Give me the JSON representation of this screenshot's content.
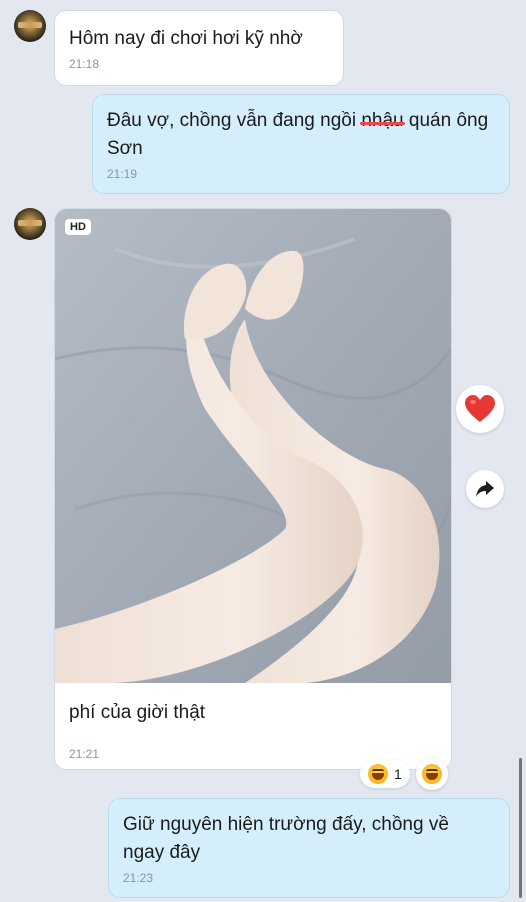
{
  "messages": [
    {
      "text": "Hôm nay đi chơi hơi kỹ nhờ",
      "time": "21:18"
    },
    {
      "text_before": "Đâu vợ, chồng vẫn đang ngồi ",
      "struck": "nhậu",
      "text_after": " quán ông Sơn",
      "time": "21:19"
    },
    {
      "badge": "HD",
      "caption": "phí của giời thật",
      "time": "21:21"
    },
    {
      "text": "Giữ nguyên hiện trường đấy, chồng về ngay đây",
      "time": "21:23"
    }
  ],
  "reaction": {
    "count": "1"
  },
  "colors": {
    "background": "#e3e7f0",
    "incoming": "#ffffff",
    "outgoing": "#d5eefc",
    "heart": "#e53935",
    "strike": "#e84a4a"
  },
  "icons": [
    "avatar",
    "heart-icon",
    "share-arrow-icon",
    "laugh-emoji-icon"
  ]
}
